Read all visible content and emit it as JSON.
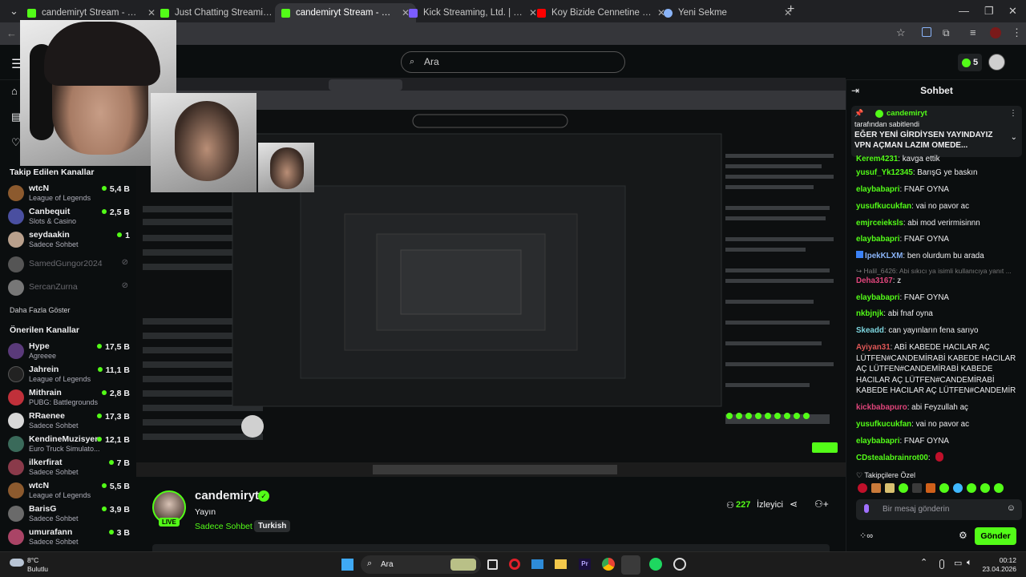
{
  "tabs": [
    {
      "title": "candemiryt Stream - Watch Live",
      "fav": "#53fc18"
    },
    {
      "title": "Just Chatting Streaming - Live S",
      "fav": "#53fc18"
    },
    {
      "title": "candemiryt Stream - Watch Live",
      "fav": "#53fc18"
    },
    {
      "title": "Kick Streaming, Ltd. | Set up pay",
      "fav": "#7b5cff"
    },
    {
      "title": "Koy Bizide Cennetine | Abdurra",
      "fav": "#ff0000"
    },
    {
      "title": "Yeni Sekme",
      "fav": "#8ab4f8"
    }
  ],
  "header": {
    "search_placeholder": "Ara",
    "kicks_count": "5"
  },
  "sidebar": {
    "followed_title": "Takip Edilen Kanallar",
    "followed": [
      {
        "name": "wtcN",
        "game": "League of Legends",
        "viewers": "5,4 B",
        "color": "#8c5a2e"
      },
      {
        "name": "Canbequit",
        "game": "Slots & Casino",
        "viewers": "2,5 B",
        "color": "#4a4fa0"
      },
      {
        "name": "seydaakin",
        "game": "Sadece Sohbet",
        "viewers": "1",
        "color": "#b9a08c"
      },
      {
        "name": "SamedGungor2024",
        "color": "#555"
      },
      {
        "name": "SercanZurna",
        "color": "#777"
      }
    ],
    "more_label": "Daha Fazla Göster",
    "recommended_title": "Önerilen Kanallar",
    "recommended": [
      {
        "name": "Hype",
        "game": "Agreeee",
        "viewers": "17,5 B",
        "color": "#5a3a7a"
      },
      {
        "name": "Jahrein",
        "game": "League of Legends",
        "viewers": "11,1 B",
        "color": "#222"
      },
      {
        "name": "Mithrain",
        "game": "PUBG: Battlegrounds",
        "viewers": "2,8 B",
        "color": "#c0303a"
      },
      {
        "name": "RRaenee",
        "game": "Sadece Sohbet",
        "viewers": "17,3 B",
        "color": "#d8d8d8"
      },
      {
        "name": "KendineMuzisyen",
        "game": "Euro Truck Simulato...",
        "viewers": "12,1 B",
        "color": "#3a6a5a"
      },
      {
        "name": "ilkerfirat",
        "game": "Sadece Sohbet",
        "viewers": "7 B",
        "color": "#8a3a4a"
      },
      {
        "name": "wtcN",
        "game": "League of Legends",
        "viewers": "5,5 B",
        "color": "#8c5a2e"
      },
      {
        "name": "BarisG",
        "game": "Sadece Sohbet",
        "viewers": "3,9 B",
        "color": "#6a6a6a"
      },
      {
        "name": "umurafann",
        "game": "Sadece Sohbet",
        "viewers": "3 B",
        "color": "#aa4466"
      }
    ]
  },
  "stream": {
    "channel": "candemiryt",
    "title": "Yayın",
    "category": "Sadece Sohbet",
    "tag": "Turkish",
    "viewers": "227",
    "viewers_label": "İzleyici",
    "live": "LIVE"
  },
  "chat": {
    "title": "Sohbet",
    "pinned_user": "candemiryt",
    "pinned_by": "tarafından sabitlendi",
    "pinned_text": "EĞER YENİ GİRDİYSEN YAYINDAYIZ VPN AÇMAN LAZIM OMEDE...",
    "messages": [
      {
        "u": "Kerem4231",
        "c": "#53fc18",
        "t": "kavga ettik"
      },
      {
        "u": "yusuf_Yk12345",
        "c": "#53fc18",
        "t": "BarışG ye baskın"
      },
      {
        "u": "elaybabapri",
        "c": "#53fc18",
        "t": "FNAF OYNA"
      },
      {
        "u": "yusufkucukfan",
        "c": "#53fc18",
        "t": "vai no pavor ac"
      },
      {
        "u": "emjrceieksls",
        "c": "#53fc18",
        "t": "abi mod verirmisinnn"
      },
      {
        "u": "elaybabapri",
        "c": "#53fc18",
        "t": "FNAF OYNA"
      },
      {
        "u": "IpekKLXM",
        "c": "#8ab4f8",
        "t": "ben olurdum bu arada"
      },
      {
        "u": "Halil_6426",
        "c": "#777",
        "t": "Abi sıkıcı ya isimli kullanıcıya yanıt ..."
      },
      {
        "u": "Deha3167",
        "c": "#e0457b",
        "t": "z"
      },
      {
        "u": "elaybabapri",
        "c": "#53fc18",
        "t": "FNAF OYNA"
      },
      {
        "u": "nkbjnjk",
        "c": "#53fc18",
        "t": "abi fnaf oyna"
      },
      {
        "u": "Skeadd",
        "c": "#7ed6df",
        "t": "can yayınların fena sarıyo"
      },
      {
        "u": "Ayiyan31",
        "c": "#e05757",
        "t": "ABİ KABEDE HACILAR AÇ LÜTFEN#CANDEMİRABİ KABEDE HACILAR AÇ LÜTFEN#CANDEMİRABİ KABEDE HACILAR AÇ LÜTFEN#CANDEMİRABİ KABEDE HACILAR AÇ LÜTFEN#CANDEMİR"
      },
      {
        "u": "kickbabapuro",
        "c": "#e0457b",
        "t": "abi Feyzullah aç"
      },
      {
        "u": "yusufkucukfan",
        "c": "#53fc18",
        "t": "vai no pavor ac"
      },
      {
        "u": "elaybabapri",
        "c": "#53fc18",
        "t": "FNAF OYNA"
      },
      {
        "u": "CDstealabrainrot00",
        "c": "#53fc18",
        "t": ""
      }
    ],
    "subs_label": "Takipçilere Özel",
    "input_placeholder": "Bir mesaj gönderin",
    "send_label": "Gönder"
  },
  "taskbar": {
    "weather_temp": "8°C",
    "weather_desc": "Bulutlu",
    "search_label": "Ara",
    "time": "00:12",
    "date": "23.04.2026"
  },
  "nested_text": {
    "followed_title": "Takip Edilen Kanallar",
    "more": "Daha Fazla Göster",
    "recommended_title": "Önerilen Kanallar",
    "chat_title": "Sohbet",
    "ara": "Ara",
    "kicks": "5"
  }
}
